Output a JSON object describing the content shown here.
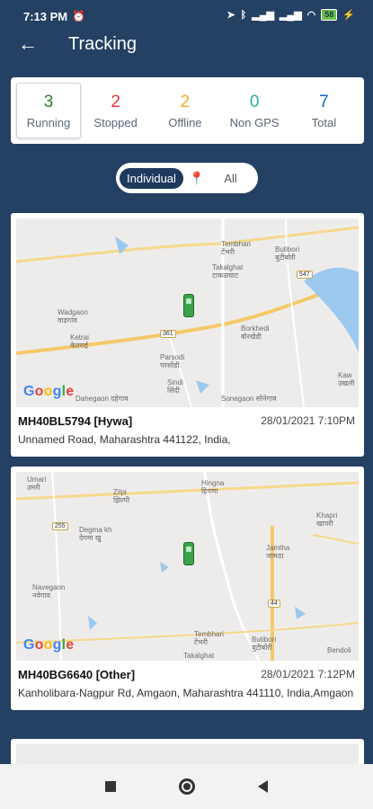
{
  "status_bar": {
    "time": "7:13 PM",
    "alarm_icon": "alarm-off-icon",
    "icons": [
      "location-icon",
      "bluetooth-icon",
      "signal-icon",
      "signal-icon",
      "wifi-icon"
    ],
    "battery": "58"
  },
  "appbar": {
    "title": "Tracking",
    "back_icon": "arrow-left-icon"
  },
  "summary": [
    {
      "count": "3",
      "label": "Running",
      "color": "#2e7d32"
    },
    {
      "count": "2",
      "label": "Stopped",
      "color": "#e53935"
    },
    {
      "count": "2",
      "label": "Offline",
      "color": "#f9a825"
    },
    {
      "count": "0",
      "label": "Non GPS",
      "color": "#26b5a0"
    },
    {
      "count": "7",
      "label": "Total",
      "color": "#1565c0"
    }
  ],
  "view_toggle": {
    "individual": "Individual",
    "all": "All",
    "pin_icon": "map-pin-icon"
  },
  "vehicles": [
    {
      "id": "MH40BL5794 [Hywa]",
      "datetime": "28/01/2021 7:10PM",
      "address": "Unnamed Road, Maharashtra 441122, India,",
      "map": {
        "places": [
          "Tembhari",
          "टेंभरी",
          "Butibori",
          "बुटीबोरी",
          "Takalghat",
          "टाकळघाट",
          "Wadgaon",
          "वाडगांव",
          "Ketrai",
          "केतराई",
          "Borkhedi",
          "बोरखेडी",
          "Parsodi",
          "परसोडी",
          "Sindi",
          "सिंदी",
          "Dahegaon",
          "दहेगाव",
          "Sonegaon",
          "सोनेगाव",
          "Kaw",
          "उखली"
        ],
        "road_labels": [
          "547",
          "361"
        ]
      }
    },
    {
      "id": "MH40BG6640 [Other]",
      "datetime": "28/01/2021 7:12PM",
      "address": "Kanholibara-Nagpur Rd, Amgaon, Maharashtra 441110, India,Amgaon",
      "map": {
        "places": [
          "Umari",
          "उमरी",
          "Zilpi",
          "झिल्पी",
          "Hingna",
          "हिंगणा",
          "Khapri",
          "खापरी",
          "Degma kh",
          "देगमा खु",
          "Jamtha",
          "जामठा",
          "Navegaon",
          "नवेगाव",
          "Tembhari",
          "टेंभरी",
          "Butibori",
          "बुटीबोरी",
          "Takalghat",
          "Bendoli"
        ],
        "road_labels": [
          "255",
          "44"
        ]
      }
    }
  ],
  "map_logo": {
    "letters": [
      "G",
      "o",
      "o",
      "g",
      "l",
      "e"
    ]
  },
  "nav": {
    "recents": "recents-icon",
    "home": "home-icon",
    "back": "back-icon"
  }
}
